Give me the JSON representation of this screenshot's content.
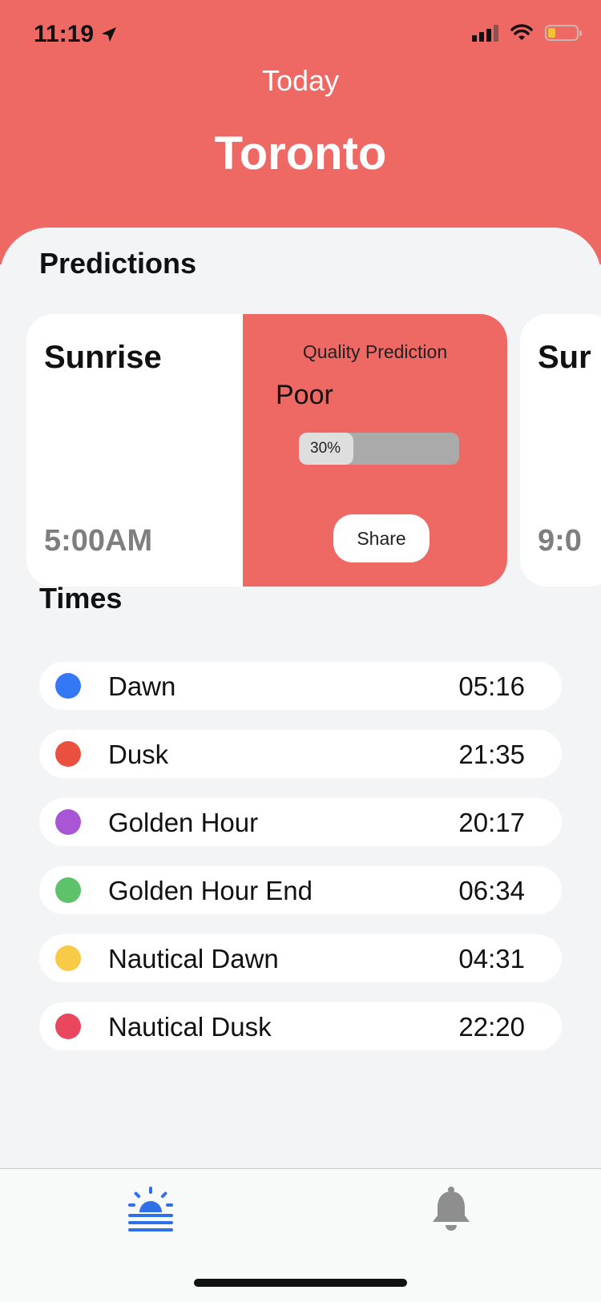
{
  "status_bar": {
    "time": "11:19",
    "battery_color": "#f3c133"
  },
  "header": {
    "subtitle": "Today",
    "city": "Toronto",
    "background": "#ee6864"
  },
  "predictions": {
    "title": "Predictions",
    "cards": [
      {
        "event": "Sunrise",
        "time": "5:00AM",
        "quality_label": "Quality Prediction",
        "quality_value": "Poor",
        "progress_percent": 30,
        "progress_text": "30%",
        "share_label": "Share"
      },
      {
        "event": "Sur",
        "time": "9:0"
      }
    ]
  },
  "times": {
    "title": "Times",
    "items": [
      {
        "label": "Dawn",
        "time": "05:16",
        "color": "#3478f6"
      },
      {
        "label": "Dusk",
        "time": "21:35",
        "color": "#e9503f"
      },
      {
        "label": "Golden Hour",
        "time": "20:17",
        "color": "#a855d6"
      },
      {
        "label": "Golden Hour End",
        "time": "06:34",
        "color": "#5ec26a"
      },
      {
        "label": "Nautical Dawn",
        "time": "04:31",
        "color": "#f7cb46"
      },
      {
        "label": "Nautical Dusk",
        "time": "22:20",
        "color": "#e8475e"
      }
    ]
  },
  "tab_bar": {
    "tabs": [
      {
        "icon": "sunrise-icon",
        "active": true,
        "color": "#2f6fe8"
      },
      {
        "icon": "bell-icon",
        "active": false,
        "color": "#8e8e8e"
      }
    ]
  }
}
